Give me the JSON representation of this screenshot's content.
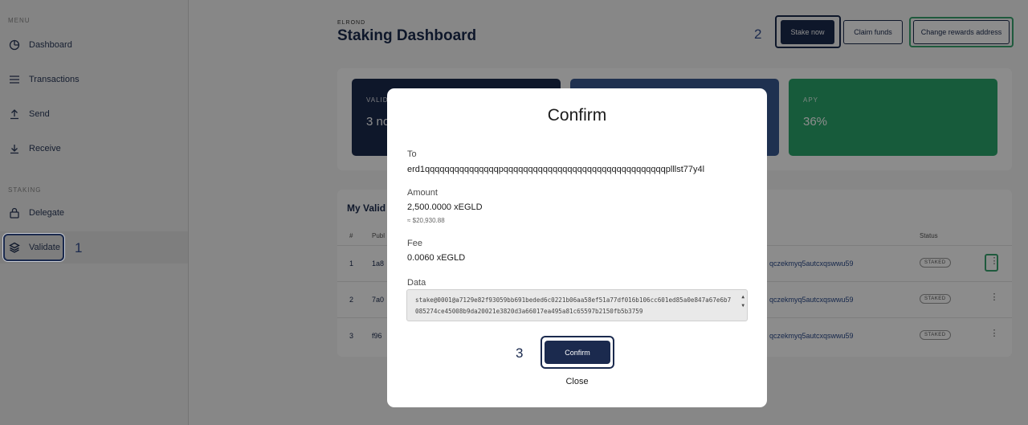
{
  "sidebar": {
    "menu_label": "MENU",
    "staking_label": "STAKING",
    "items": [
      {
        "label": "Dashboard"
      },
      {
        "label": "Transactions"
      },
      {
        "label": "Send"
      },
      {
        "label": "Receive"
      },
      {
        "label": "Delegate"
      },
      {
        "label": "Validate"
      }
    ]
  },
  "annotations": {
    "step1": "1",
    "step2": "2",
    "step3": "3"
  },
  "header": {
    "brand": "ELROND",
    "title": "Staking Dashboard",
    "stake_now": "Stake now",
    "claim_funds": "Claim funds",
    "change_rewards": "Change rewards address"
  },
  "stats": [
    {
      "label": "VALID",
      "value": "3 no"
    },
    {
      "label": "",
      "value": ""
    },
    {
      "label": "APY",
      "value": "36%"
    }
  ],
  "validators": {
    "title": "My Valid",
    "col_num": "#",
    "col_public": "Publ",
    "col_status": "Status",
    "rows": [
      {
        "num": "1",
        "key": "1a8",
        "addr": "qczekmyq5autcxqswwu59",
        "status": "STAKED"
      },
      {
        "num": "2",
        "key": "7a0",
        "addr": "qczekmyq5autcxqswwu59",
        "status": "STAKED"
      },
      {
        "num": "3",
        "key": "f96",
        "addr": "qczekmyq5autcxqswwu59",
        "status": "STAKED"
      }
    ]
  },
  "modal": {
    "title": "Confirm",
    "to_label": "To",
    "to_value": "erd1qqqqqqqqqqqqqqqpqqqqqqqqqqqqqqqqqqqqqqqqqqqqqqqqqplllst77y4l",
    "amount_label": "Amount",
    "amount_value": "2,500.0000 xEGLD",
    "amount_usd": "≈ $20,930.88",
    "fee_label": "Fee",
    "fee_value": "0.0060 xEGLD",
    "data_label": "Data",
    "data_value": "stake@0001@a7129e82f93059bb691beded6c0221b06aa58ef51a77df016b106cc601ed85a0e847a67e6b7085274ce45008b9da20021e3820d3a66017ea495a81c65597b2150fb5b3759",
    "confirm_label": "Confirm",
    "close_label": "Close"
  }
}
